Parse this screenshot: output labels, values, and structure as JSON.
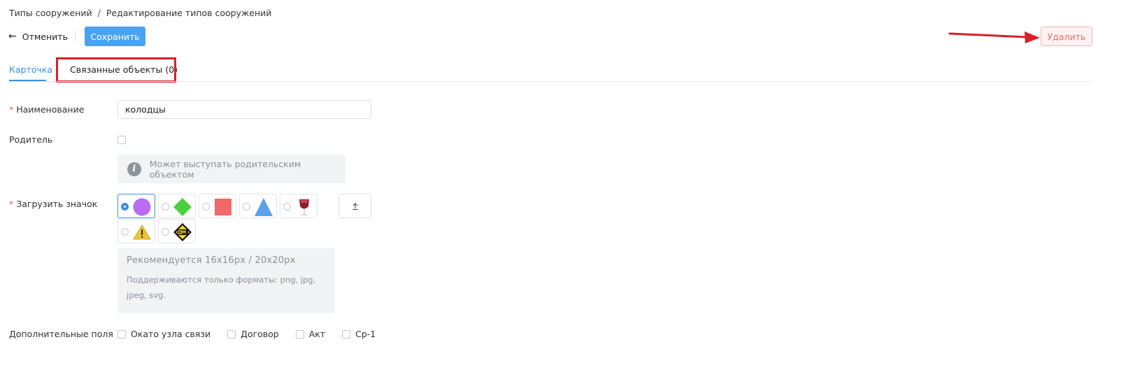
{
  "breadcrumb": {
    "root": "Типы сооружений",
    "separator": "/",
    "current": "Редактирование типов сооружений"
  },
  "toolbar": {
    "back_icon": "←",
    "cancel_label": "Отменить",
    "save_label": "Сохранить",
    "delete_label": "Удалить"
  },
  "tabs": [
    {
      "label": "Карточка",
      "active": true
    },
    {
      "label": "Связанные объекты (0)",
      "active": false
    }
  ],
  "form": {
    "name": {
      "required_mark": "*",
      "label": "Наименование",
      "value": "колодцы"
    },
    "parent": {
      "label": "Родитель",
      "checked": false,
      "hint_icon": "i",
      "hint": "Может выступать родительским объектом"
    },
    "icon": {
      "required_mark": "*",
      "label": "Загрузить значок",
      "options": [
        {
          "name": "purple-circle-icon",
          "selected": true,
          "color": "#b96cf2"
        },
        {
          "name": "green-diamond-icon",
          "selected": false,
          "color": "#4ccf3e"
        },
        {
          "name": "red-square-icon",
          "selected": false,
          "color": "#f26868"
        },
        {
          "name": "blue-triangle-icon",
          "selected": false,
          "color": "#5aa2e8"
        },
        {
          "name": "wine-glass-icon",
          "selected": false,
          "color": "#8f1e2e"
        },
        {
          "name": "warning-icon",
          "selected": false,
          "color": "#f1c232"
        },
        {
          "name": "cm-diamond-icon",
          "selected": false,
          "color": "#f5d90a"
        }
      ],
      "upload_icon": "upload-icon",
      "recommend_title": "Рекомендуется 16x16px / 20x20px",
      "recommend_text": "Поддерживаются только форматы: png, jpg, jpeg, svg."
    },
    "extra": {
      "label": "Дополнительные поля",
      "options": [
        {
          "label": "Окато узла связи",
          "checked": false
        },
        {
          "label": "Договор",
          "checked": false
        },
        {
          "label": "Акт",
          "checked": false
        },
        {
          "label": "Ср-1",
          "checked": false
        }
      ]
    }
  },
  "colors": {
    "primary": "#4aa3f0",
    "danger": "#e06b6b",
    "annotation": "#d8202a"
  }
}
